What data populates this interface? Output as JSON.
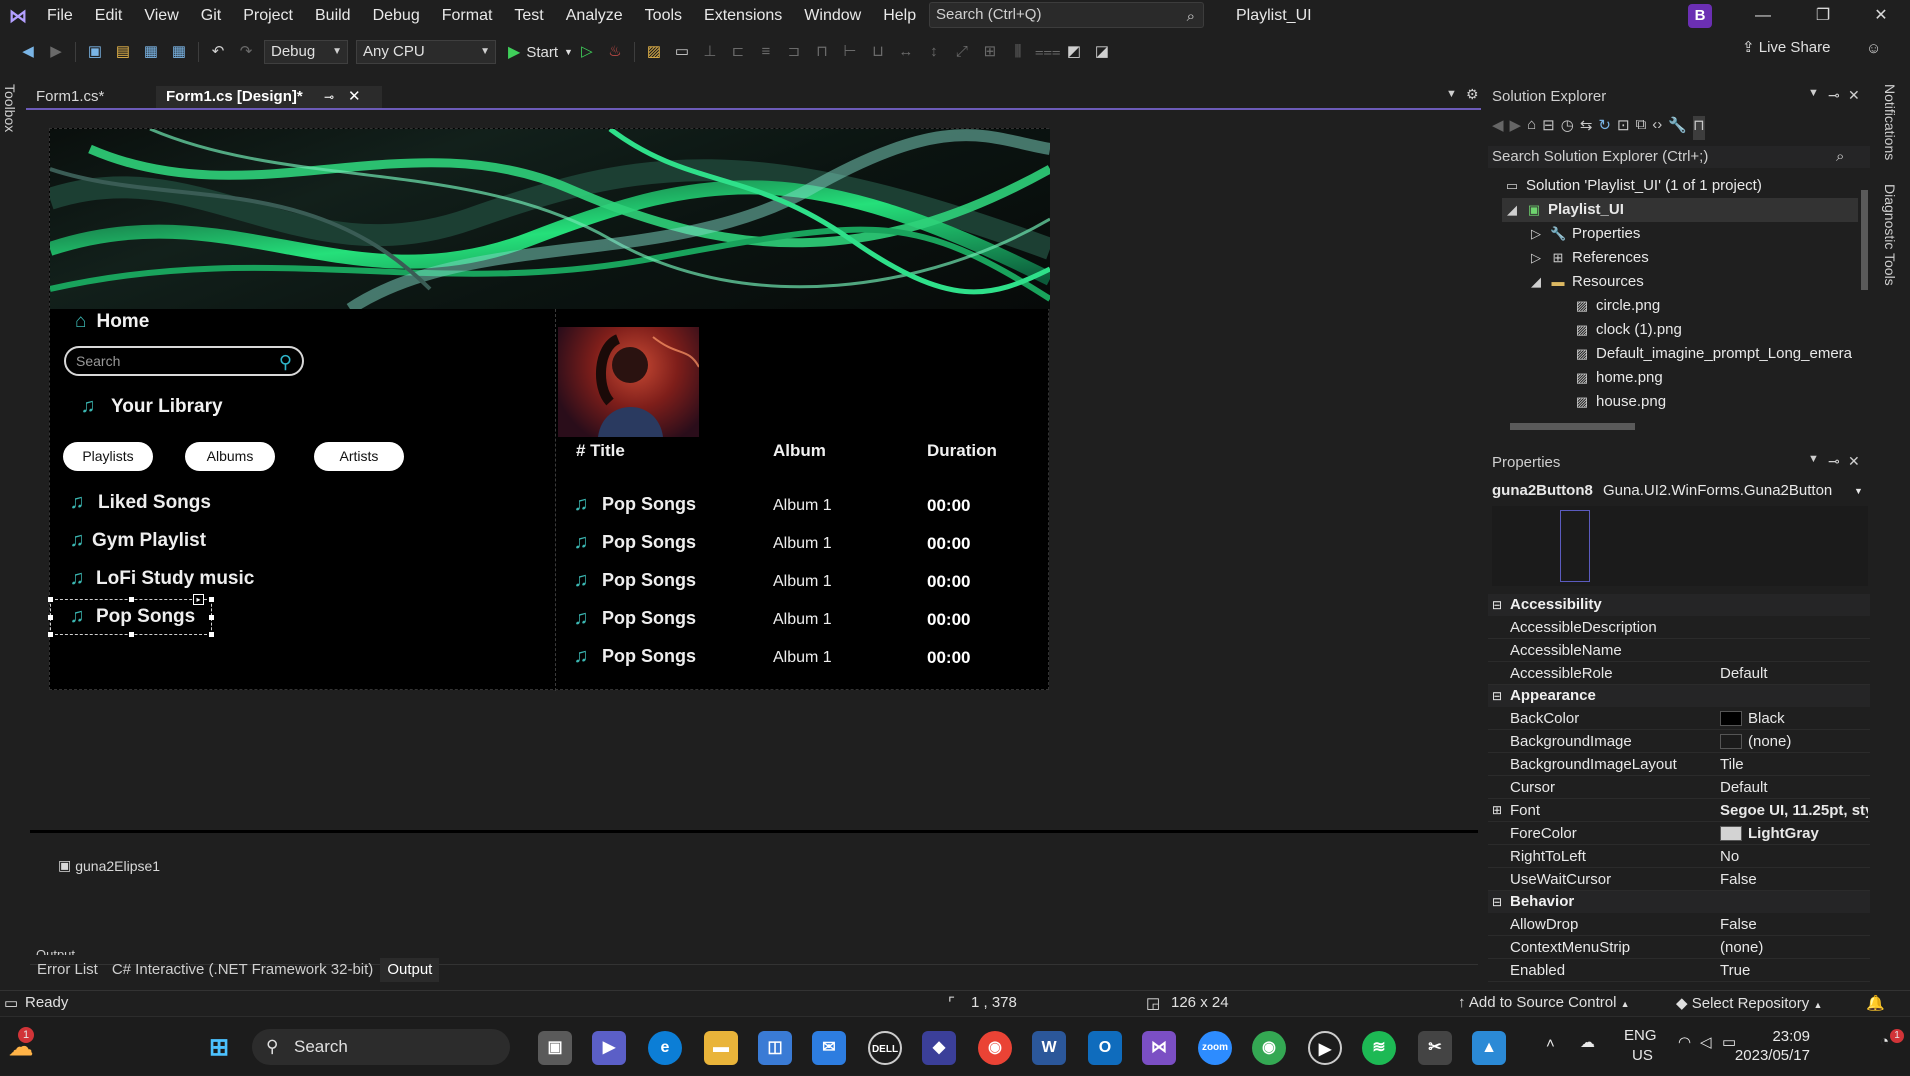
{
  "menubar": {
    "items": [
      "File",
      "Edit",
      "View",
      "Git",
      "Project",
      "Build",
      "Debug",
      "Format",
      "Test",
      "Analyze",
      "Tools",
      "Extensions",
      "Window",
      "Help"
    ],
    "search_placeholder": "Search (Ctrl+Q)",
    "title": "Playlist_UI",
    "avatar_letter": "B"
  },
  "toolbar": {
    "config": "Debug",
    "platform": "Any CPU",
    "start_label": "Start",
    "live_share": "Live Share"
  },
  "sidebars": {
    "left": "Toolbox",
    "right_top": "Notifications",
    "right_bottom": "Diagnostic Tools"
  },
  "doc_tabs": [
    {
      "label": "Form1.cs*",
      "active": false
    },
    {
      "label": "Form1.cs [Design]*",
      "active": true
    }
  ],
  "form": {
    "home_label": "Home",
    "search_placeholder": "Search",
    "library_label": "Your Library",
    "filters": [
      "Playlists",
      "Albums",
      "Artists"
    ],
    "playlists": [
      "Liked Songs",
      "Gym Playlist",
      "LoFi Study music",
      "Pop Songs"
    ],
    "columns": {
      "title": "# Title",
      "album": "Album",
      "duration": "Duration"
    },
    "songs": [
      {
        "title": "Pop Songs",
        "album": "Album 1",
        "duration": "00:00"
      },
      {
        "title": "Pop Songs",
        "album": "Album 1",
        "duration": "00:00"
      },
      {
        "title": "Pop Songs",
        "album": "Album 1",
        "duration": "00:00"
      },
      {
        "title": "Pop Songs",
        "album": "Album 1",
        "duration": "00:00"
      },
      {
        "title": "Pop Songs",
        "album": "Album 1",
        "duration": "00:00"
      }
    ],
    "accent_color": "#3bb7b2"
  },
  "component_tray": {
    "item": "guna2Elipse1"
  },
  "bottom_tabs": [
    "Error List",
    "C# Interactive (.NET Framework 32-bit)",
    "Output"
  ],
  "output_label": "Output",
  "solution_explorer": {
    "title": "Solution Explorer",
    "search": "Search Solution Explorer (Ctrl+;)",
    "nodes": [
      {
        "label": "Solution 'Playlist_UI' (1 of 1 project)"
      },
      {
        "label": "Playlist_UI"
      },
      {
        "label": "Properties"
      },
      {
        "label": "References"
      },
      {
        "label": "Resources"
      },
      {
        "label": "circle.png"
      },
      {
        "label": "clock (1).png"
      },
      {
        "label": "Default_imagine_prompt_Long_emera"
      },
      {
        "label": "home.png"
      },
      {
        "label": "house.png"
      }
    ]
  },
  "properties": {
    "title": "Properties",
    "object_name": "guna2Button8",
    "object_type": "Guna.UI2.WinForms.Guna2Button",
    "categories": {
      "accessibility": "Accessibility",
      "appearance": "Appearance",
      "behavior": "Behavior"
    },
    "rows": {
      "accessible_description": {
        "name": "AccessibleDescription",
        "value": ""
      },
      "accessible_name": {
        "name": "AccessibleName",
        "value": ""
      },
      "accessible_role": {
        "name": "AccessibleRole",
        "value": "Default"
      },
      "back_color": {
        "name": "BackColor",
        "value": "Black",
        "swatch": "#000000"
      },
      "background_image": {
        "name": "BackgroundImage",
        "value": "(none)",
        "swatch": "#1b1b1b"
      },
      "background_image_layout": {
        "name": "BackgroundImageLayout",
        "value": "Tile"
      },
      "cursor": {
        "name": "Cursor",
        "value": "Default"
      },
      "font": {
        "name": "Font",
        "value": "Segoe UI, 11.25pt, sty"
      },
      "fore_color": {
        "name": "ForeColor",
        "value": "LightGray",
        "swatch": "#d3d3d3"
      },
      "right_to_left": {
        "name": "RightToLeft",
        "value": "No"
      },
      "use_wait_cursor": {
        "name": "UseWaitCursor",
        "value": "False"
      },
      "allow_drop": {
        "name": "AllowDrop",
        "value": "False"
      },
      "context_menu_strip": {
        "name": "ContextMenuStrip",
        "value": "(none)"
      },
      "enabled": {
        "name": "Enabled",
        "value": "True"
      }
    }
  },
  "statusbar": {
    "ready": "Ready",
    "position": "1 , 378",
    "size": "126 x 24",
    "source_control": "Add to Source Control",
    "repository": "Select Repository"
  },
  "taskbar": {
    "search": "Search",
    "lang": "ENG",
    "region": "US",
    "time": "23:09",
    "date": "2023/05/17",
    "weather_badge": "1",
    "notif_badge": "1"
  }
}
